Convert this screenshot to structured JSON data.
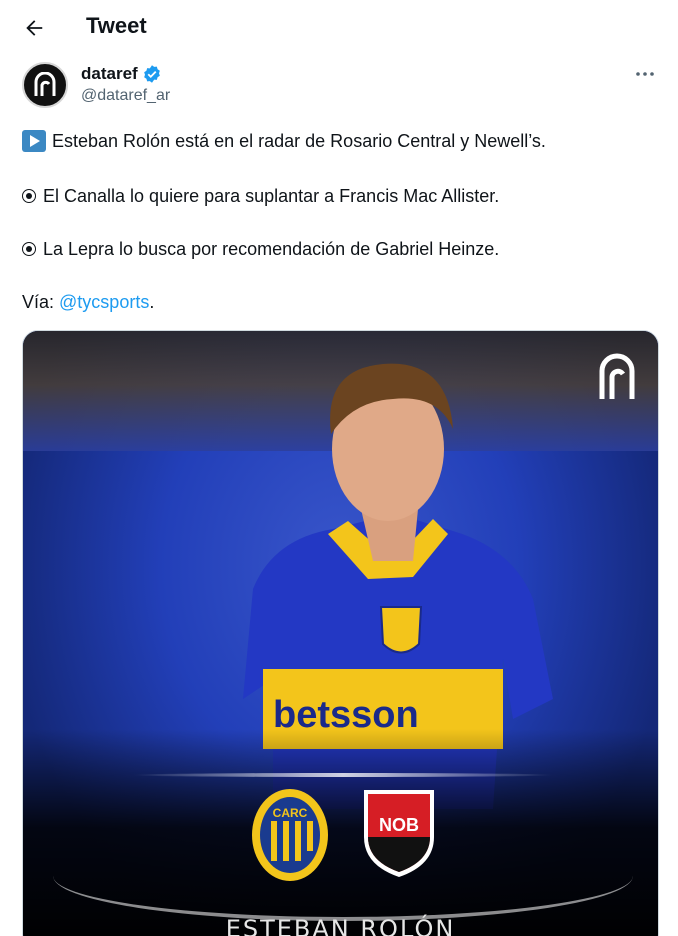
{
  "header": {
    "title": "Tweet",
    "back_icon": "arrow-left-icon"
  },
  "author": {
    "display_name": "dataref",
    "handle": "@dataref_ar",
    "verified": true,
    "verified_color": "#1d9bf0"
  },
  "tweet": {
    "line1": "Esteban Rolón está en el radar de Rosario Central y Newell’s.",
    "line2": "El Canalla lo quiere para suplantar a Francis Mac Allister.",
    "line3": "La Lepra lo busca por recomendación de Gabriel Heinze.",
    "via_label": "Vía: ",
    "mention": "@tycsports",
    "via_suffix": ".",
    "mention_color": "#1d9bf0"
  },
  "media": {
    "player_name": "ESTEBAN ROLÓN",
    "jersey_sponsor": "betsson",
    "crest_left_text": "CARC",
    "crest_right_text": "NOB"
  }
}
